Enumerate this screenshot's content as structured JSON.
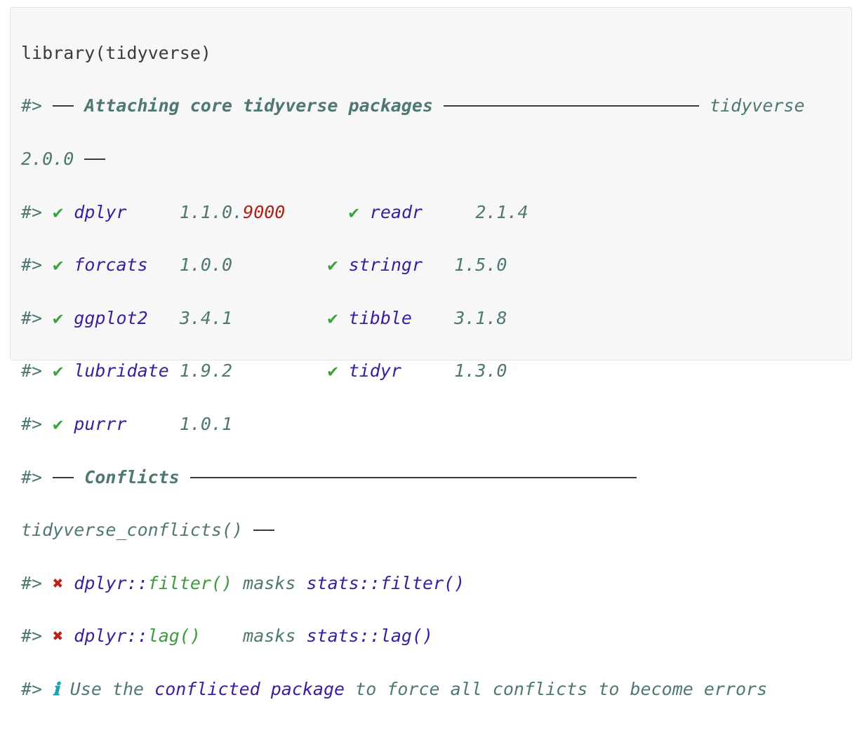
{
  "code": {
    "line1": "library(tidyverse)",
    "prompt": "#>",
    "attach_header": "Attaching core tidyverse packages",
    "version_label": "tidyverse",
    "version_value": "2.0.0",
    "check_icon": "check-icon",
    "cross_icon": "cross-icon",
    "info_icon": "info-icon",
    "check": "✔",
    "cross": "✖",
    "info": "ℹ",
    "packages": [
      {
        "name": "dplyr",
        "version": "1.1.0.",
        "version_dev": "9000"
      },
      {
        "name": "readr",
        "version": "2.1.4"
      },
      {
        "name": "forcats",
        "version": "1.0.0"
      },
      {
        "name": "stringr",
        "version": "1.5.0"
      },
      {
        "name": "ggplot2",
        "version": "3.4.1"
      },
      {
        "name": "tibble",
        "version": "3.1.8"
      },
      {
        "name": "lubridate",
        "version": "1.9.2"
      },
      {
        "name": "tidyr",
        "version": "1.3.0"
      },
      {
        "name": "purrr",
        "version": "1.0.1"
      }
    ],
    "conflicts_header": "Conflicts",
    "conflicts_fn": "tidyverse_conflicts()",
    "conflicts": [
      {
        "pkg": "dplyr::",
        "fn": "filter()",
        "pad": " ",
        "masks": "masks",
        "other_pkg": "stats::",
        "other_fn": "filter()"
      },
      {
        "pkg": "dplyr::",
        "fn": "lag()",
        "pad": "    ",
        "masks": "masks",
        "other_pkg": "stats::",
        "other_fn": "lag()"
      }
    ],
    "info_text_1": "Use the",
    "info_text_2": "conflicted package",
    "info_text_3": "to force all conflicts to become errors"
  },
  "colors": {
    "background": "#f7f7f7",
    "comment": "#4f7872",
    "package": "#3b1d9f",
    "check": "#3ba33b",
    "cross": "#c0201b",
    "info": "#1aa3b0"
  }
}
